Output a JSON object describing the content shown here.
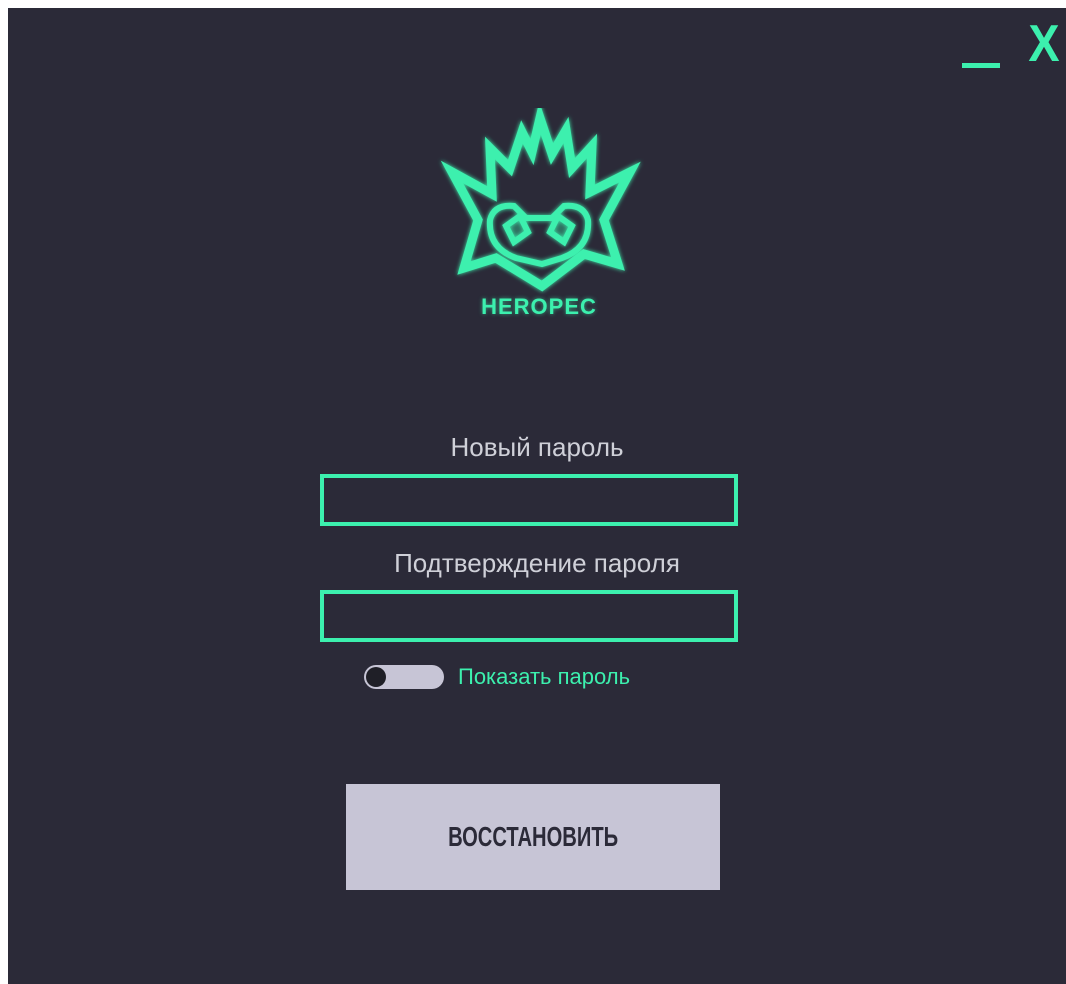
{
  "window": {
    "minimize_label": "_",
    "close_label": "X"
  },
  "logo": {
    "text": "HEROPEC",
    "icon": "dragon-head-logo"
  },
  "form": {
    "new_password_label": "Новый пароль",
    "new_password_value": "",
    "confirm_password_label": "Подтверждение пароля",
    "confirm_password_value": "",
    "show_password_label": "Показать пароль",
    "show_password_enabled": false,
    "submit_label": "ВОССТАНОВИТЬ"
  },
  "colors": {
    "background": "#2b2a38",
    "accent": "#3cf0ae",
    "button": "#c7c5d6",
    "label_text": "#cfd0d8"
  }
}
